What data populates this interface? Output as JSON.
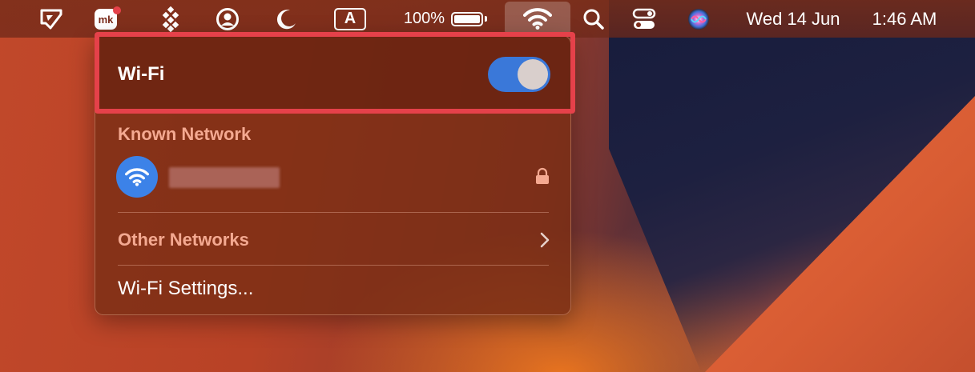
{
  "menubar": {
    "battery_percent": "100%",
    "input_source": "A",
    "date": "Wed 14 Jun",
    "time": "1:46 AM"
  },
  "wifi_panel": {
    "title": "Wi-Fi",
    "toggle_on": true,
    "known_network_label": "Known Network",
    "known_network_name": "",
    "other_networks_label": "Other Networks",
    "settings_label": "Wi-Fi Settings..."
  },
  "colors": {
    "highlight": "#e5414a",
    "toggle_on": "#3a78d9",
    "network_icon": "#3c82e8",
    "section_text": "#f4a991"
  },
  "icons": [
    "app-icon",
    "mk-app-icon",
    "pinwheel-icon",
    "user-circle-icon",
    "moon-icon",
    "input-source-icon",
    "battery-icon",
    "wifi-icon",
    "search-icon",
    "control-center-icon",
    "siri-icon",
    "lock-icon",
    "chevron-right-icon"
  ]
}
